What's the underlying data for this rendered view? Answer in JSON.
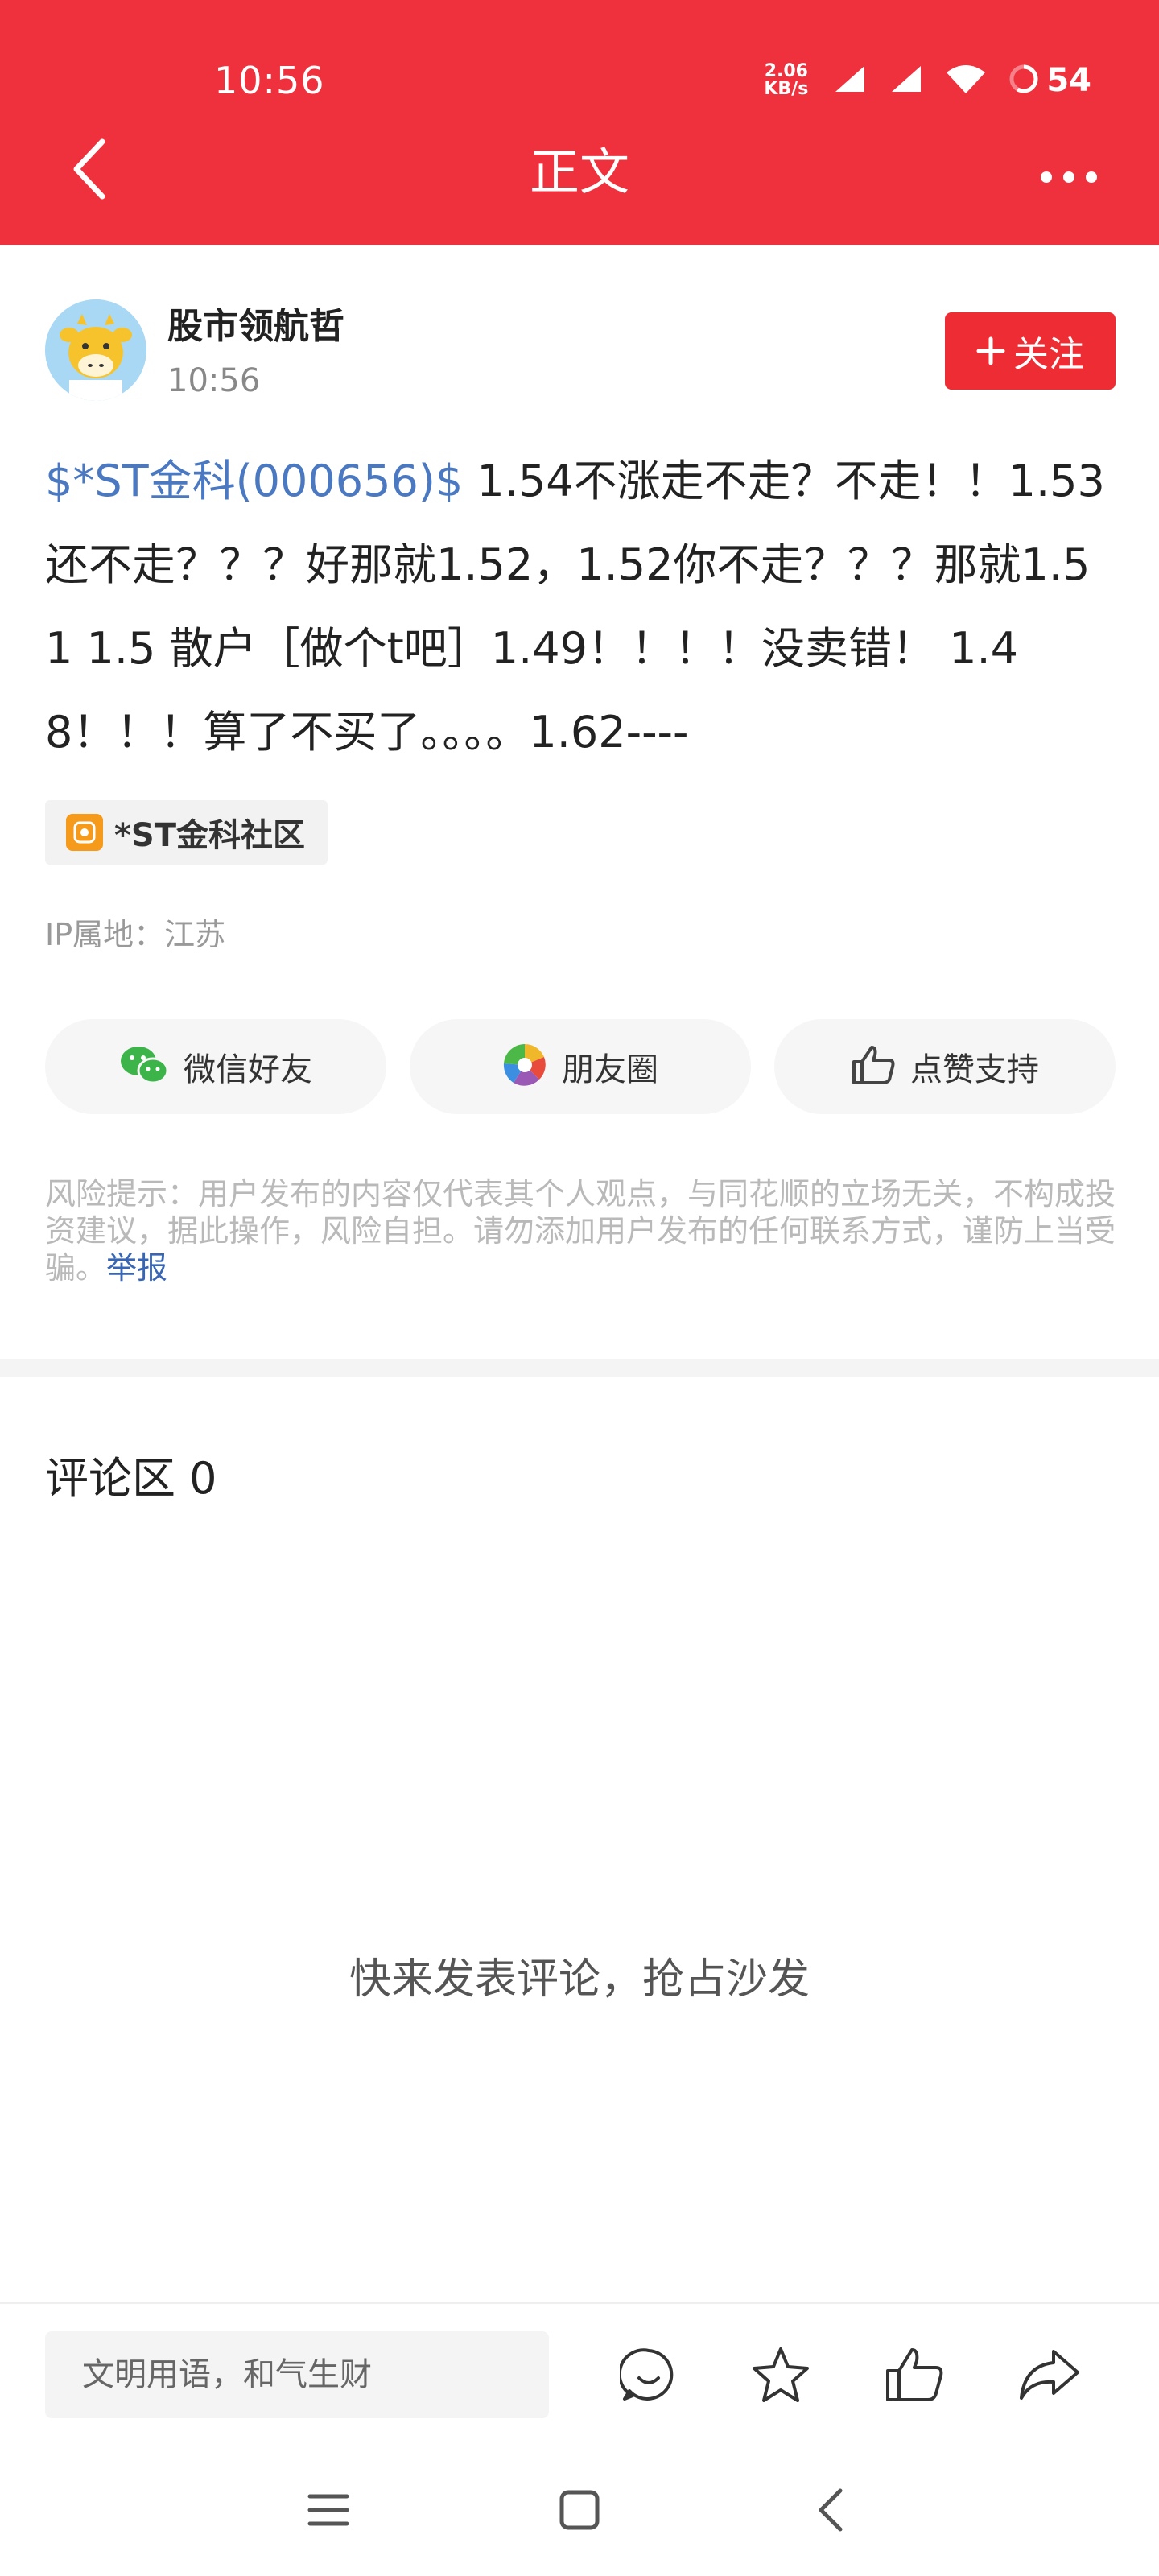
{
  "status_bar": {
    "time": "10:56",
    "net_speed_value": "2.06",
    "net_speed_unit": "KB/s",
    "battery": "54",
    "icons": [
      "signal-icon",
      "signal-icon",
      "wifi-icon",
      "battery-icon"
    ]
  },
  "header": {
    "title": "正文",
    "back_icon": "chevron-left-icon",
    "more_icon": "more-icon"
  },
  "author": {
    "name": "股市领航哲",
    "time": "10:56",
    "follow_label": "关注",
    "follow_icon": "plus-icon"
  },
  "post": {
    "stock_link": "$*ST金科(000656)$",
    "text": " 1.54不涨走不走？不走！！1.53还不走？？？好那就1.52，1.52你不走？？？那就1.51 1.5 散户［做个t吧］1.49！！！！没卖错！ 1.48！！！算了不买了。。。。1.62----"
  },
  "community_tag": {
    "label": "*ST金科社区",
    "icon": "community-icon",
    "icon_color": "#f59a1b"
  },
  "ip_location": "IP属地：江苏",
  "share": {
    "wechat": "微信好友",
    "moments": "朋友圈",
    "like": "点赞支持"
  },
  "risk_notice": {
    "text": "风险提示：用户发布的内容仅代表其个人观点，与同花顺的立场无关，不构成投资建议，据此操作，风险自担。请勿添加用户发布的任何联系方式，谨防上当受骗。",
    "report_label": "举报"
  },
  "comments": {
    "title": "评论区 0",
    "empty_text": "快来发表评论，抢占沙发"
  },
  "bottom_bar": {
    "input_placeholder": "文明用语，和气生财",
    "icons": [
      "comment-icon",
      "star-icon",
      "thumbs-up-icon",
      "share-icon"
    ]
  },
  "nav_bar": {
    "icons": [
      "menu-icon",
      "home-icon",
      "back-icon"
    ]
  },
  "colors": {
    "brand_red": "#ef303d",
    "link_blue": "#4a79c2"
  }
}
